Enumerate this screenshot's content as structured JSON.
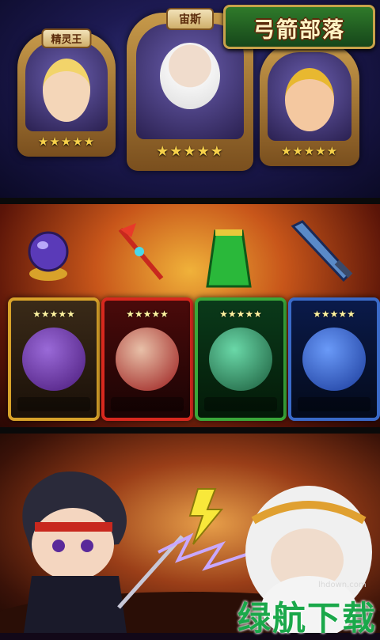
{
  "title_logo": "弓箭部落",
  "heroes": [
    {
      "name": "精灵王",
      "stars": "★★★★★"
    },
    {
      "name": "宙斯",
      "stars": "★★★★★"
    },
    {
      "name": "",
      "stars": "★★★★★"
    }
  ],
  "items": [
    {
      "icon": "crystal-orb-icon"
    },
    {
      "icon": "red-scepter-icon"
    },
    {
      "icon": "green-cloak-icon"
    },
    {
      "icon": "ice-sword-icon"
    }
  ],
  "cards": [
    {
      "stars": "★★★★★",
      "frame_color": "#d8a22a",
      "monster_color": "#6a3a9a"
    },
    {
      "stars": "★★★★★",
      "frame_color": "#d8281e",
      "monster_color": "#9a1a1a"
    },
    {
      "stars": "★★★★★",
      "frame_color": "#3aa83a",
      "monster_color": "#3a8a6a"
    },
    {
      "stars": "★★★★★",
      "frame_color": "#3a6ac8",
      "monster_color": "#2a5ad8"
    }
  ],
  "watermark": {
    "site": "lhdown.com",
    "text": "绿航下载"
  },
  "colors": {
    "gold": "#f6d04a",
    "brand_green": "#1aa84a"
  }
}
